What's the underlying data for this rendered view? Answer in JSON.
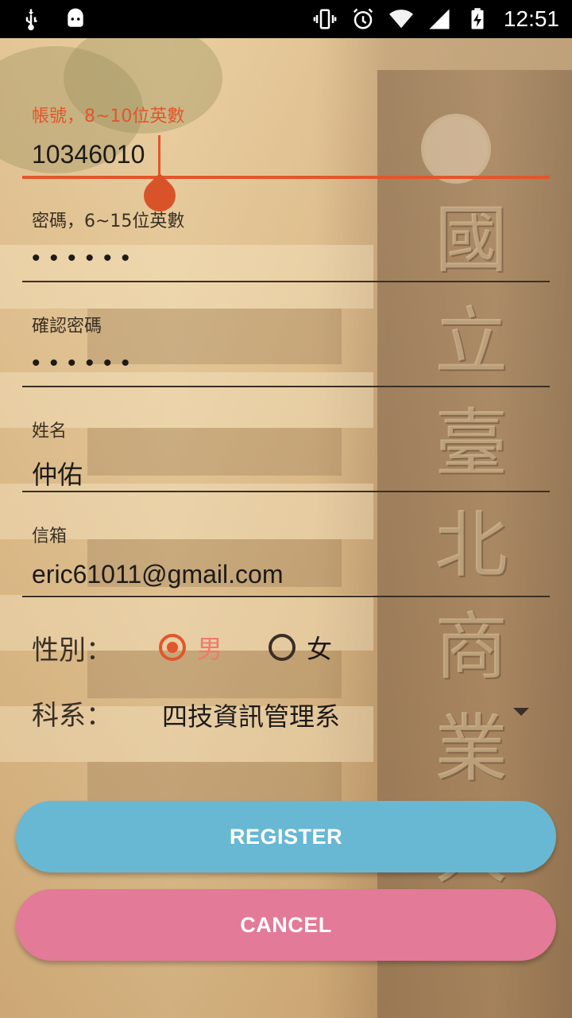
{
  "status_bar": {
    "time": "12:51",
    "icons_left": [
      "usb-icon",
      "android-icon"
    ],
    "icons_right": [
      "vibrate-icon",
      "alarm-icon",
      "wifi-icon",
      "signal-icon",
      "battery-charging-icon"
    ]
  },
  "form": {
    "account": {
      "label": "帳號，8~10位英數",
      "value": "10346010",
      "focused": true
    },
    "password": {
      "label": "密碼，6~15位英數",
      "value": "••••••"
    },
    "confirm": {
      "label": "確認密碼",
      "value": "••••••"
    },
    "name": {
      "label": "姓名",
      "value": "仲佑"
    },
    "email": {
      "label": "信箱",
      "value": "eric61011@gmail.com"
    },
    "gender": {
      "label": "性別：",
      "options": [
        {
          "label": "男",
          "selected": true
        },
        {
          "label": "女",
          "selected": false
        }
      ]
    },
    "department": {
      "label": "科系：",
      "selected": "四技資訊管理系"
    }
  },
  "buttons": {
    "register": "REGISTER",
    "cancel": "CANCEL"
  },
  "background": {
    "engraved_text": [
      "國",
      "立",
      "臺",
      "北",
      "商",
      "業",
      "大"
    ]
  },
  "colors": {
    "accent": "#e2562b",
    "register": "#68b8d4",
    "cancel": "#e27a98"
  }
}
